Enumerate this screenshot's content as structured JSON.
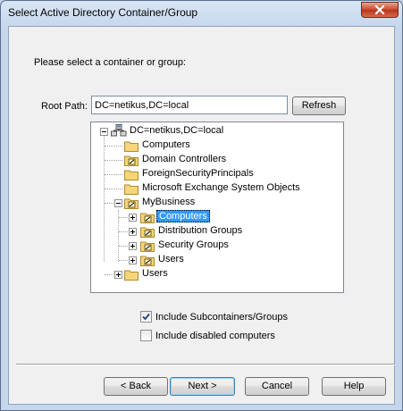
{
  "window": {
    "title": "Select Active Directory Container/Group"
  },
  "dialog": {
    "prompt": "Please select a container or group:",
    "root_path_label": "Root Path:",
    "root_path_value": "DC=netikus,DC=local",
    "refresh_label": "Refresh"
  },
  "tree": {
    "root": {
      "label": "DC=netikus,DC=local",
      "icon": "domain-icon",
      "expanded": true
    },
    "items": [
      {
        "label": "Computers",
        "icon": "folder-icon",
        "has_children": false
      },
      {
        "label": "Domain Controllers",
        "icon": "ou-folder-icon",
        "has_children": false
      },
      {
        "label": "ForeignSecurityPrincipals",
        "icon": "folder-icon",
        "has_children": false
      },
      {
        "label": "Microsoft Exchange System Objects",
        "icon": "folder-icon",
        "has_children": false
      },
      {
        "label": "MyBusiness",
        "icon": "ou-folder-icon",
        "expanded": true
      },
      {
        "label": "Computers",
        "icon": "ou-folder-icon",
        "collapsed": true,
        "selected": true
      },
      {
        "label": "Distribution Groups",
        "icon": "ou-folder-icon",
        "collapsed": true
      },
      {
        "label": "Security Groups",
        "icon": "ou-folder-icon",
        "collapsed": true
      },
      {
        "label": "Users",
        "icon": "ou-folder-icon",
        "collapsed": true
      },
      {
        "label": "Users",
        "icon": "folder-icon",
        "collapsed": true
      }
    ]
  },
  "options": {
    "include_subcontainers": {
      "label": "Include Subcontainers/Groups",
      "checked": true
    },
    "include_disabled": {
      "label": "Include disabled computers",
      "checked": false
    }
  },
  "buttons": {
    "back": "< Back",
    "next": "Next >",
    "cancel": "Cancel",
    "help": "Help"
  },
  "colors": {
    "selection": "#3399ff",
    "close_button": "#c9462c",
    "title_gradient": "#d9e6f5"
  }
}
